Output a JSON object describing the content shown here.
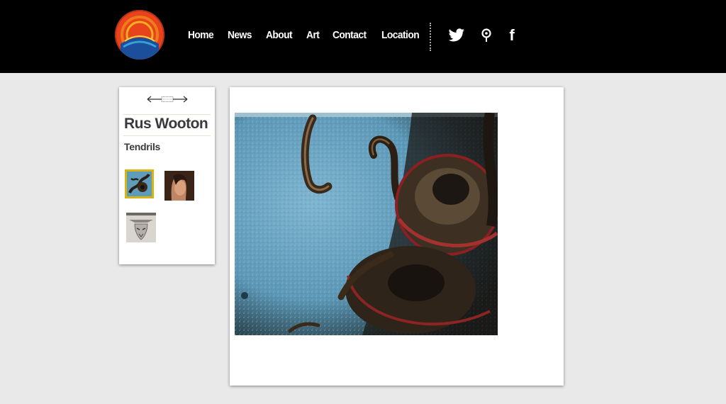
{
  "nav": {
    "items": [
      {
        "label": "Home"
      },
      {
        "label": "News"
      },
      {
        "label": "About"
      },
      {
        "label": "Art"
      },
      {
        "label": "Contact"
      },
      {
        "label": "Location"
      }
    ]
  },
  "social": {
    "icons": [
      "twitter-icon",
      "location-pin-icon",
      "facebook-icon"
    ],
    "facebook_glyph": "f"
  },
  "sidebar": {
    "artist": "Rus Wooton",
    "artwork_title": "Tendrils",
    "thumbnails": [
      {
        "name": "thumbnail-tendrils",
        "selected": true
      },
      {
        "name": "thumbnail-portrait",
        "selected": false
      },
      {
        "name": "thumbnail-skull",
        "selected": false
      }
    ]
  },
  "colors": {
    "header_bg": "#000000",
    "page_bg": "#e9e9e9",
    "selected_thumb_border": "#d7b412"
  }
}
